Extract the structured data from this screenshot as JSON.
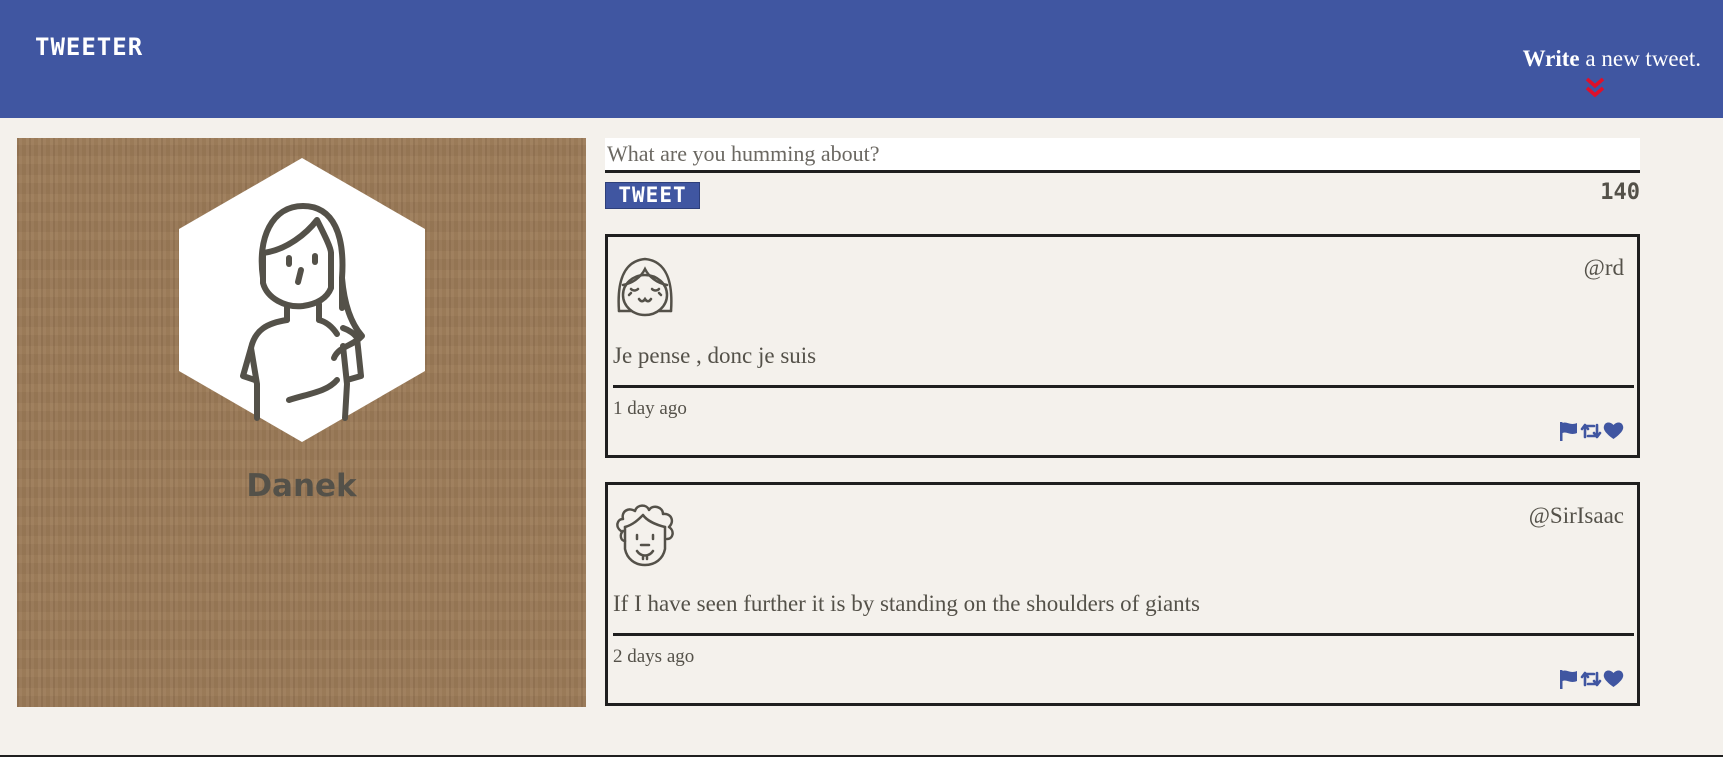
{
  "app": {
    "brand": "TWEETER"
  },
  "nav": {
    "compose_bold": "Write",
    "compose_rest": " a new tweet.",
    "compose_icon": "double-chevron-down-icon"
  },
  "profile": {
    "name": "Danek",
    "avatar_icon": "woman-avatar-icon"
  },
  "composer": {
    "placeholder": "What are you humming about?",
    "value": "",
    "button_label": "TWEET",
    "counter": "140"
  },
  "tweets": [
    {
      "handle": "@rd",
      "content": "Je pense , donc je suis",
      "time": "1 day ago",
      "avatar_icon": "girl-avatar-icon",
      "actions": [
        "flag-icon",
        "retweet-icon",
        "heart-icon"
      ]
    },
    {
      "handle": "@SirIsaac",
      "content": "If I have seen further it is by standing on the shoulders of giants",
      "time": "2 days ago",
      "avatar_icon": "curly-man-avatar-icon",
      "actions": [
        "flag-icon",
        "retweet-icon",
        "heart-icon"
      ]
    }
  ],
  "colors": {
    "nav_background": "#4056a1",
    "page_background": "#f4f1ec",
    "text": "#545149",
    "accent_red": "#e0102a",
    "icon_blue": "#4056a1"
  }
}
